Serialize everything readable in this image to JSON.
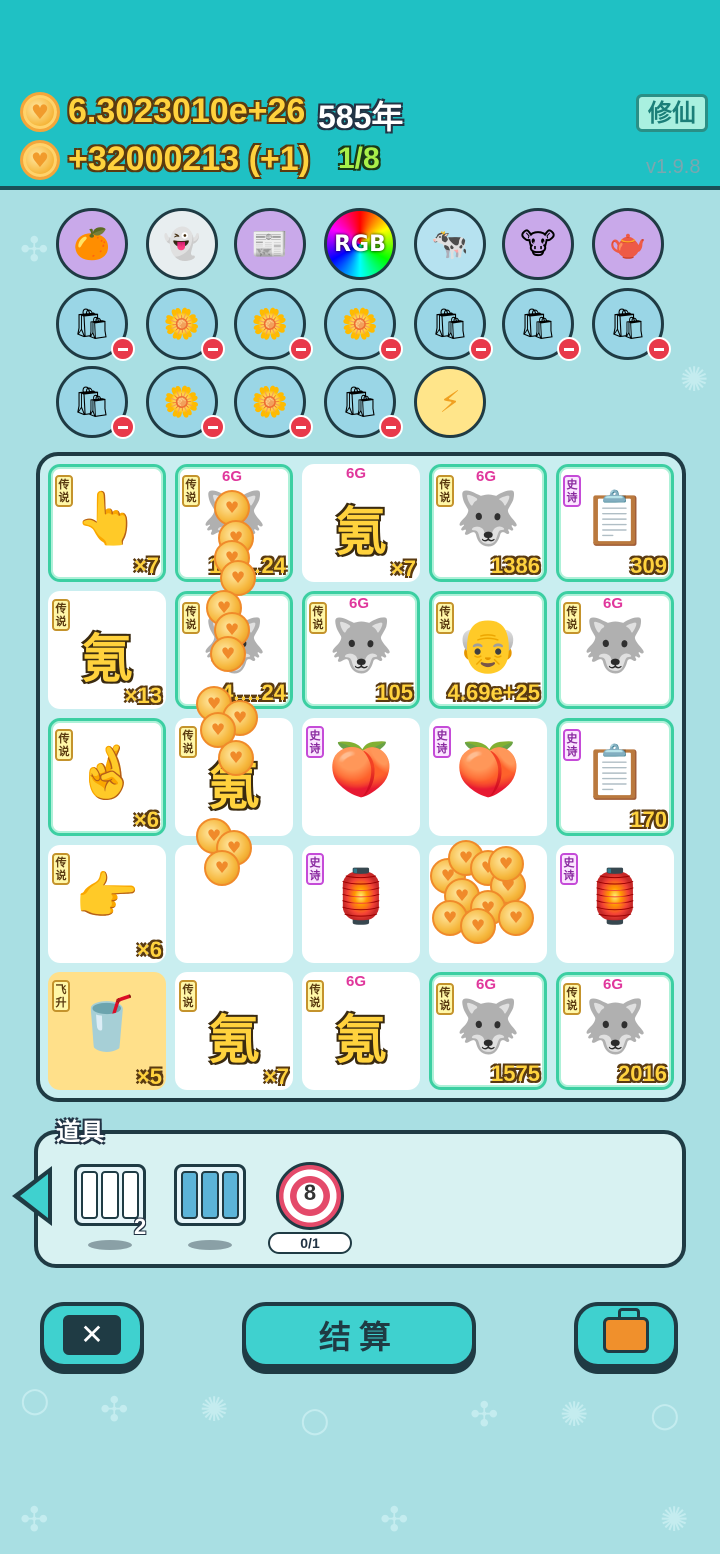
{
  "header": {
    "total_coins": "6.3023010e+26",
    "years": "585年",
    "income": "+32000213 (+1)",
    "progress": "1/8",
    "xiuxian_button": "修仙",
    "version": "v1.9.8"
  },
  "top_row": [
    {
      "name": "grapefruit-icon",
      "glyph": "🍊"
    },
    {
      "name": "ghost-icon",
      "glyph": "👻"
    },
    {
      "name": "time-magazine-icon",
      "glyph": "📰"
    },
    {
      "name": "rgb-icon",
      "glyph": "RGB"
    },
    {
      "name": "cows-icon",
      "glyph": "🐄"
    },
    {
      "name": "ox-card-icon",
      "glyph": "🐮"
    },
    {
      "name": "gravy-boat-icon",
      "glyph": "🫖"
    }
  ],
  "board": {
    "cells": [
      {
        "tag": "传说",
        "g6": "",
        "icon": "👆",
        "count": "×7",
        "style": "green"
      },
      {
        "tag": "传说",
        "g6": "6G",
        "icon": "🐺",
        "count": "1.4…24",
        "style": "green"
      },
      {
        "tag": "",
        "g6": "6G",
        "char": "氪",
        "count": "×7",
        "style": "plain"
      },
      {
        "tag": "传说",
        "g6": "6G",
        "icon": "🐺",
        "count": "1386",
        "style": "green"
      },
      {
        "tag": "史诗",
        "g6": "",
        "icon": "📋",
        "count": "309",
        "style": "green"
      },
      {
        "tag": "传说",
        "g6": "",
        "char": "氪",
        "count": "×13",
        "style": "plain"
      },
      {
        "tag": "传说",
        "g6": "",
        "icon": "🐺",
        "count": "4.…24",
        "style": "green"
      },
      {
        "tag": "传说",
        "g6": "6G",
        "icon": "🐺",
        "count": "105",
        "style": "green"
      },
      {
        "tag": "传说",
        "g6": "",
        "icon": "👴",
        "count": "4.69e+25",
        "style": "green"
      },
      {
        "tag": "传说",
        "g6": "6G",
        "icon": "🐺",
        "count": "",
        "style": "green"
      },
      {
        "tag": "传说",
        "g6": "",
        "icon": "🤞",
        "count": "×6",
        "style": "green"
      },
      {
        "tag": "传说",
        "g6": "",
        "char": "氪",
        "count": "",
        "style": "plain"
      },
      {
        "tag": "史诗",
        "g6": "",
        "icon": "🍑",
        "count": "",
        "style": "plain"
      },
      {
        "tag": "史诗",
        "g6": "",
        "icon": "🍑",
        "count": "",
        "style": "plain"
      },
      {
        "tag": "史诗",
        "g6": "",
        "icon": "📋",
        "count": "170",
        "style": "green"
      },
      {
        "tag": "传说",
        "g6": "",
        "icon": "👉",
        "count": "×6",
        "style": "plain"
      },
      {
        "tag": "",
        "g6": "",
        "icon": "",
        "count": "",
        "style": "plain"
      },
      {
        "tag": "史诗",
        "g6": "",
        "icon": "🏮",
        "count": "",
        "style": "plain"
      },
      {
        "tag": "",
        "g6": "",
        "icon": "",
        "count": "",
        "style": "plain"
      },
      {
        "tag": "史诗",
        "g6": "",
        "icon": "🏮",
        "count": "",
        "style": "plain"
      },
      {
        "tag": "飞升",
        "g6": "",
        "icon": "🥤",
        "count": "×5",
        "style": "gold"
      },
      {
        "tag": "传说",
        "g6": "",
        "char": "氪",
        "count": "×7",
        "style": "plain"
      },
      {
        "tag": "传说",
        "g6": "6G",
        "char": "氪",
        "count": "",
        "style": "plain"
      },
      {
        "tag": "传说",
        "g6": "6G",
        "icon": "🐺",
        "count": "1575",
        "style": "green"
      },
      {
        "tag": "传说",
        "g6": "6G",
        "icon": "🐺",
        "count": "2016",
        "style": "green"
      }
    ]
  },
  "items": {
    "label": "道具",
    "slot1_count": "2",
    "target_number": "8",
    "target_progress": "0/1"
  },
  "footer": {
    "settle_label": "结算"
  },
  "colors": {
    "header_bg": "#1fc1c4",
    "accent_teal": "#3fd1cf",
    "gold": "#ffd23d"
  }
}
